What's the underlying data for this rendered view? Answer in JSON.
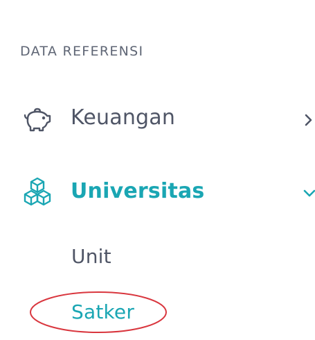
{
  "colors": {
    "accent": "#1aa6b3",
    "text": "#4f5566",
    "heading": "#5f6675",
    "annotation": "#d9363e"
  },
  "sidebar": {
    "section_heading": "DATA REFERENSI",
    "items": [
      {
        "label": "Keuangan",
        "icon": "piggy-bank-icon",
        "chevron": "chevron-right-icon",
        "active": false
      },
      {
        "label": "Universitas",
        "icon": "cubes-icon",
        "chevron": "chevron-down-icon",
        "active": true,
        "children": [
          {
            "label": "Unit",
            "active": false
          },
          {
            "label": "Satker",
            "active": true
          }
        ]
      }
    ]
  },
  "annotation": {
    "shape": "ellipse",
    "target": "Satker"
  }
}
